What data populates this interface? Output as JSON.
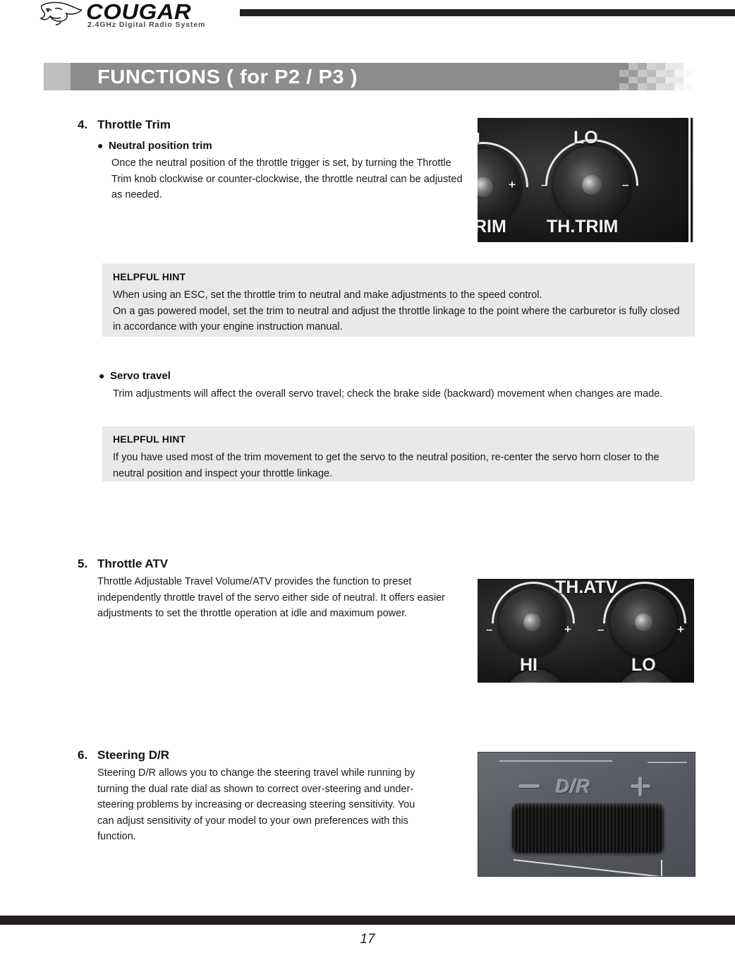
{
  "header": {
    "brand": "COUGAR",
    "tagline": "2.4GHz Digital Radio System"
  },
  "banner": {
    "title": "FUNCTIONS ( for P2 / P3 )"
  },
  "sections": [
    {
      "number": "4.",
      "title": "Throttle Trim",
      "bullets": [
        {
          "marker": "●",
          "label": "Neutral position trim",
          "body": "Once the neutral position of the throttle trigger is set, by turning the Throttle Trim knob clockwise or counter-clockwise, the throttle neutral can be adjusted as needed."
        },
        {
          "marker": "●",
          "label": "Servo travel",
          "body": "Trim adjustments will affect the overall servo travel; check the brake side (backward) movement when changes are made."
        }
      ],
      "hints": [
        {
          "title": "HELPFUL HINT",
          "body": "When using an ESC, set the throttle trim to neutral and make adjustments to the speed control.\nOn a gas powered model, set the trim to neutral and adjust the throttle linkage to the point where the carburetor is fully closed in accordance with your engine instruction manual."
        },
        {
          "title": "HELPFUL HINT",
          "body": "If you have used most of the trim movement to get the servo to the neutral position, re-center the servo horn closer to the neutral position and inspect your throttle linkage."
        }
      ]
    },
    {
      "number": "5.",
      "title": "Throttle ATV",
      "body": "Throttle Adjustable Travel Volume/ATV provides the function to preset independently throttle travel of the servo either side of neutral. It offers easier adjustments to set the throttle operation at idle and maximum power."
    },
    {
      "number": "6.",
      "title": "Steering D/R",
      "body": "Steering D/R allows you to change the steering travel while running by turning the dual rate dial as shown to correct over-steering and under-steering problems by increasing or decreasing steering sensitivity. You can adjust sensitivity of your model to your own preferences with this function."
    }
  ],
  "photos": {
    "throttle_trim": {
      "labels": {
        "lo": "LO",
        "trim_partial": "RIM",
        "th_trim": "TH.TRIM",
        "hi_partial": "I",
        "plus": "+",
        "minus_left": "–",
        "minus_right": "–"
      }
    },
    "throttle_atv": {
      "labels": {
        "title": "TH.ATV",
        "hi": "HI",
        "lo": "LO",
        "minus_left": "–",
        "plus_left": "+",
        "minus_right": "–",
        "plus_right": "+"
      }
    },
    "steering_dr": {
      "labels": {
        "dial": "D/R",
        "minus": "–",
        "plus": "+"
      }
    }
  },
  "footer": {
    "page_number": "17"
  }
}
